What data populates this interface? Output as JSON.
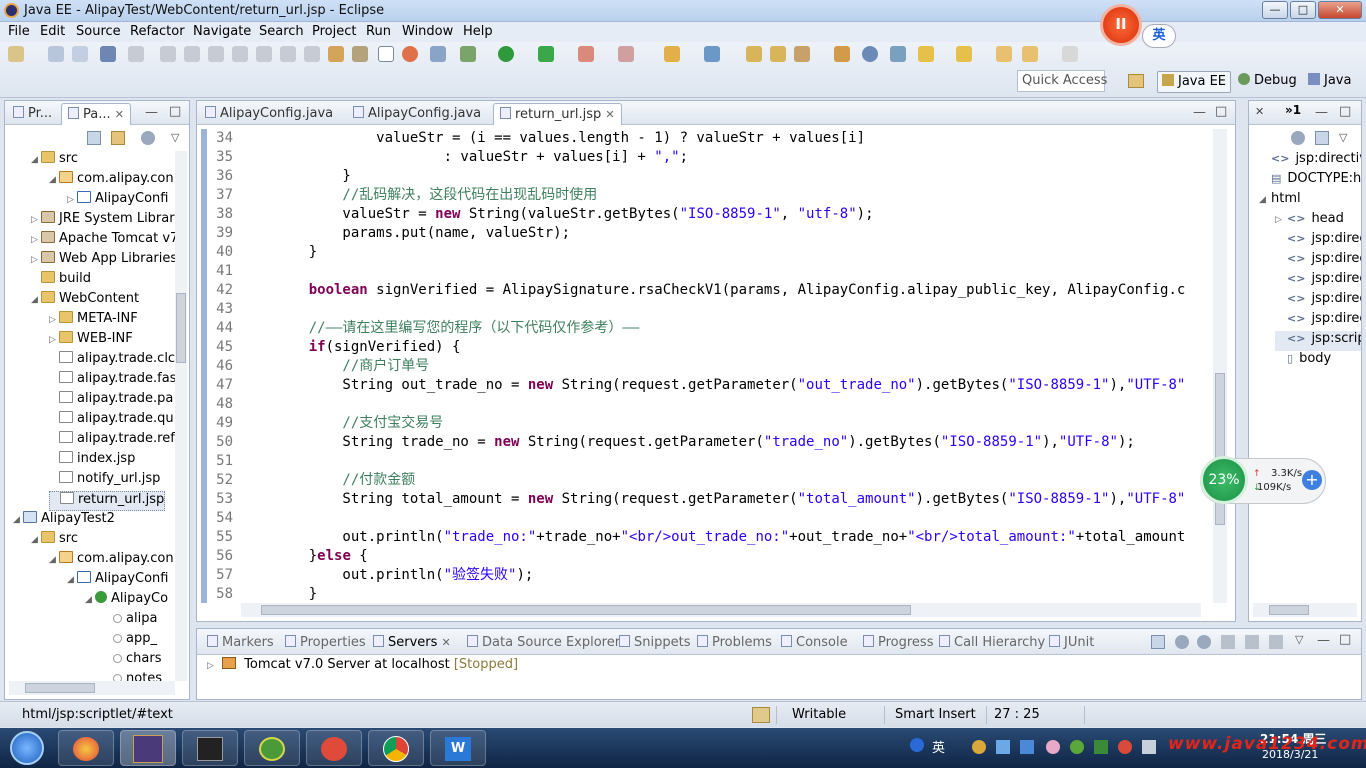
{
  "window": {
    "title": "Java EE - AlipayTest/WebContent/return_url.jsp - Eclipse",
    "btn_min": "—",
    "btn_max": "□",
    "btn_close": "✕"
  },
  "menu": [
    "File",
    "Edit",
    "Source",
    "Refactor",
    "Navigate",
    "Search",
    "Project",
    "Run",
    "Window",
    "Help"
  ],
  "toolbar": {
    "quick_access": "Quick Access",
    "perspectives": [
      "Java EE",
      "Debug",
      "Java"
    ]
  },
  "recorder": {
    "pause_label": "II",
    "ime_label": "英"
  },
  "explorer": {
    "tabs": [
      "Pr...",
      "Pa..."
    ],
    "close_glyph": "✕",
    "tree": [
      {
        "label": "src",
        "icon": "folder-icon",
        "level": 1,
        "exp": "open"
      },
      {
        "label": "com.alipay.con",
        "icon": "package-icon",
        "level": 2,
        "exp": "open"
      },
      {
        "label": "AlipayConfi",
        "icon": "java-file-icon",
        "level": 3,
        "exp": "closed"
      },
      {
        "label": "JRE System Library",
        "icon": "library-icon",
        "level": 1,
        "exp": "closed"
      },
      {
        "label": "Apache Tomcat v7",
        "icon": "library-icon",
        "level": 1,
        "exp": "closed"
      },
      {
        "label": "Web App Libraries",
        "icon": "library-icon",
        "level": 1,
        "exp": "closed"
      },
      {
        "label": "build",
        "icon": "folder-icon",
        "level": 1,
        "exp": ""
      },
      {
        "label": "WebContent",
        "icon": "folder-icon",
        "level": 1,
        "exp": "open"
      },
      {
        "label": "META-INF",
        "icon": "folder-icon",
        "level": 2,
        "exp": "closed"
      },
      {
        "label": "WEB-INF",
        "icon": "folder-icon",
        "level": 2,
        "exp": "closed"
      },
      {
        "label": "alipay.trade.clc",
        "icon": "file-icon",
        "level": 2,
        "exp": ""
      },
      {
        "label": "alipay.trade.fas",
        "icon": "file-icon",
        "level": 2,
        "exp": ""
      },
      {
        "label": "alipay.trade.pa",
        "icon": "file-icon",
        "level": 2,
        "exp": ""
      },
      {
        "label": "alipay.trade.qu",
        "icon": "file-icon",
        "level": 2,
        "exp": ""
      },
      {
        "label": "alipay.trade.ref",
        "icon": "file-icon",
        "level": 2,
        "exp": ""
      },
      {
        "label": "index.jsp",
        "icon": "file-icon",
        "level": 2,
        "exp": ""
      },
      {
        "label": "notify_url.jsp",
        "icon": "file-icon",
        "level": 2,
        "exp": ""
      },
      {
        "label": "return_url.jsp",
        "icon": "file-icon",
        "level": 2,
        "exp": "",
        "selected": true
      },
      {
        "label": "AlipayTest2",
        "icon": "project-icon",
        "level": 0,
        "exp": "open"
      },
      {
        "label": "src",
        "icon": "folder-icon",
        "level": 1,
        "exp": "open"
      },
      {
        "label": "com.alipay.con",
        "icon": "package-icon",
        "level": 2,
        "exp": "open"
      },
      {
        "label": "AlipayConfi",
        "icon": "java-file-icon",
        "level": 3,
        "exp": "open"
      },
      {
        "label": "AlipayCo",
        "icon": "class-icon",
        "level": 4,
        "exp": "open"
      },
      {
        "label": "alipa",
        "icon": "field-icon",
        "level": 5,
        "exp": ""
      },
      {
        "label": "app_",
        "icon": "field-icon",
        "level": 5,
        "exp": ""
      },
      {
        "label": "chars",
        "icon": "field-icon",
        "level": 5,
        "exp": ""
      },
      {
        "label": "notes",
        "icon": "field-icon",
        "level": 5,
        "exp": ""
      }
    ]
  },
  "editor": {
    "tabs": [
      {
        "label": "AlipayConfig.java"
      },
      {
        "label": "AlipayConfig.java"
      },
      {
        "label": "return_url.jsp",
        "active": true
      }
    ],
    "close_glyph": "✕",
    "lines": [
      {
        "n": "34",
        "t": [
          [
            "",
            "            valueStr = (i == values.length - 1) ? valueStr + values[i]"
          ]
        ]
      },
      {
        "n": "35",
        "t": [
          [
            "",
            "                    : valueStr + values[i] + "
          ],
          [
            "str",
            "\",\""
          ],
          [
            "",
            ";"
          ]
        ]
      },
      {
        "n": "36",
        "t": [
          [
            "",
            "        }"
          ]
        ]
      },
      {
        "n": "37",
        "t": [
          [
            "cm",
            "        //乱码解决，这段代码在出现乱码时使用"
          ]
        ]
      },
      {
        "n": "38",
        "t": [
          [
            "",
            "        valueStr = "
          ],
          [
            "kw",
            "new"
          ],
          [
            "",
            " String(valueStr.getBytes("
          ],
          [
            "str",
            "\"ISO-8859-1\""
          ],
          [
            "",
            ", "
          ],
          [
            "str",
            "\"utf-8\""
          ],
          [
            "",
            ");"
          ]
        ]
      },
      {
        "n": "39",
        "t": [
          [
            "",
            "        params.put(name, valueStr);"
          ]
        ]
      },
      {
        "n": "40",
        "t": [
          [
            "",
            "    }"
          ]
        ]
      },
      {
        "n": "41",
        "t": [
          [
            "",
            ""
          ]
        ]
      },
      {
        "n": "42",
        "t": [
          [
            "",
            "    "
          ],
          [
            "kw",
            "boolean"
          ],
          [
            "",
            " signVerified = AlipaySignature.rsaCheckV1(params, AlipayConfig.alipay_public_key, AlipayConfig.c"
          ]
        ]
      },
      {
        "n": "43",
        "t": [
          [
            "",
            ""
          ]
        ]
      },
      {
        "n": "44",
        "t": [
          [
            "cm",
            "    //——请在这里编写您的程序（以下代码仅作参考）——"
          ]
        ]
      },
      {
        "n": "45",
        "t": [
          [
            "kw",
            "    if"
          ],
          [
            "",
            "(signVerified) {"
          ]
        ]
      },
      {
        "n": "46",
        "t": [
          [
            "cm",
            "        //商户订单号"
          ]
        ]
      },
      {
        "n": "47",
        "t": [
          [
            "",
            "        String out_trade_no = "
          ],
          [
            "kw",
            "new"
          ],
          [
            "",
            " String(request.getParameter("
          ],
          [
            "str",
            "\"out_trade_no\""
          ],
          [
            "",
            ").getBytes("
          ],
          [
            "str",
            "\"ISO-8859-1\""
          ],
          [
            "",
            "),"
          ],
          [
            "str",
            "\"UTF-8\""
          ]
        ]
      },
      {
        "n": "48",
        "t": [
          [
            "",
            ""
          ]
        ]
      },
      {
        "n": "49",
        "t": [
          [
            "cm",
            "        //支付宝交易号"
          ]
        ]
      },
      {
        "n": "50",
        "t": [
          [
            "",
            "        String trade_no = "
          ],
          [
            "kw",
            "new"
          ],
          [
            "",
            " String(request.getParameter("
          ],
          [
            "str",
            "\"trade_no\""
          ],
          [
            "",
            ").getBytes("
          ],
          [
            "str",
            "\"ISO-8859-1\""
          ],
          [
            "",
            "),"
          ],
          [
            "str",
            "\"UTF-8\""
          ],
          [
            "",
            ");"
          ]
        ]
      },
      {
        "n": "51",
        "t": [
          [
            "",
            ""
          ]
        ]
      },
      {
        "n": "52",
        "t": [
          [
            "cm",
            "        //付款金额"
          ]
        ]
      },
      {
        "n": "53",
        "t": [
          [
            "",
            "        String total_amount = "
          ],
          [
            "kw",
            "new"
          ],
          [
            "",
            " String(request.getParameter("
          ],
          [
            "str",
            "\"total_amount\""
          ],
          [
            "",
            ").getBytes("
          ],
          [
            "str",
            "\"ISO-8859-1\""
          ],
          [
            "",
            "),"
          ],
          [
            "str",
            "\"UTF-8\""
          ]
        ]
      },
      {
        "n": "54",
        "t": [
          [
            "",
            ""
          ]
        ]
      },
      {
        "n": "55",
        "t": [
          [
            "",
            "        out.println("
          ],
          [
            "str",
            "\"trade_no:\""
          ],
          [
            "",
            "+trade_no+"
          ],
          [
            "str",
            "\"<br/>out_trade_no:\""
          ],
          [
            "",
            "+out_trade_no+"
          ],
          [
            "str",
            "\"<br/>total_amount:\""
          ],
          [
            "",
            "+total_amount"
          ]
        ]
      },
      {
        "n": "56",
        "t": [
          [
            "",
            "    }"
          ],
          [
            "kw",
            "else"
          ],
          [
            "",
            " {"
          ]
        ]
      },
      {
        "n": "57",
        "t": [
          [
            "",
            "        out.println("
          ],
          [
            "str",
            "\"验签失败\""
          ],
          [
            "",
            ");"
          ]
        ]
      },
      {
        "n": "58",
        "t": [
          [
            "",
            "    }"
          ]
        ]
      }
    ]
  },
  "outline": {
    "tab_label": "»1",
    "close_glyph": "✕",
    "items": [
      {
        "label": "jsp:directive",
        "level": 0,
        "icon": "tag-icon",
        "exp": ""
      },
      {
        "label": "DOCTYPE:ht",
        "level": 0,
        "icon": "doctype-icon",
        "exp": ""
      },
      {
        "label": "html",
        "level": 0,
        "icon": "",
        "exp": "open"
      },
      {
        "label": "head",
        "level": 1,
        "icon": "tag-icon",
        "exp": "closed"
      },
      {
        "label": "jsp:direc",
        "level": 1,
        "icon": "tag-icon",
        "exp": ""
      },
      {
        "label": "jsp:direc",
        "level": 1,
        "icon": "tag-icon",
        "exp": ""
      },
      {
        "label": "jsp:direc",
        "level": 1,
        "icon": "tag-icon",
        "exp": ""
      },
      {
        "label": "jsp:direc",
        "level": 1,
        "icon": "tag-icon",
        "exp": ""
      },
      {
        "label": "jsp:direc",
        "level": 1,
        "icon": "tag-icon",
        "exp": ""
      },
      {
        "label": "jsp:scrip",
        "level": 1,
        "icon": "tag-icon",
        "exp": "",
        "selected": true
      },
      {
        "label": "body",
        "level": 1,
        "icon": "file-icon",
        "exp": ""
      }
    ]
  },
  "bottom": {
    "tabs": [
      "Markers",
      "Properties",
      "Servers",
      "Data Source Explorer",
      "Snippets",
      "Problems",
      "Console",
      "Progress",
      "Call Hierarchy",
      "JUnit"
    ],
    "active_tab": "Servers",
    "close_glyph": "✕",
    "server_name": "Tomcat v7.0 Server at localhost",
    "server_status": "[Stopped]"
  },
  "status": {
    "path": "html/jsp:scriptlet/#text",
    "writable": "Writable",
    "insert_mode": "Smart Insert",
    "position": "27 : 25"
  },
  "net": {
    "cpu": "23%",
    "up": "3.3K/s",
    "down": "109K/s",
    "plus": "+"
  },
  "taskbar": {
    "ime": "英",
    "time": "21:54 周三",
    "date": "2018/3/21",
    "watermark": "www.java1234.com"
  }
}
